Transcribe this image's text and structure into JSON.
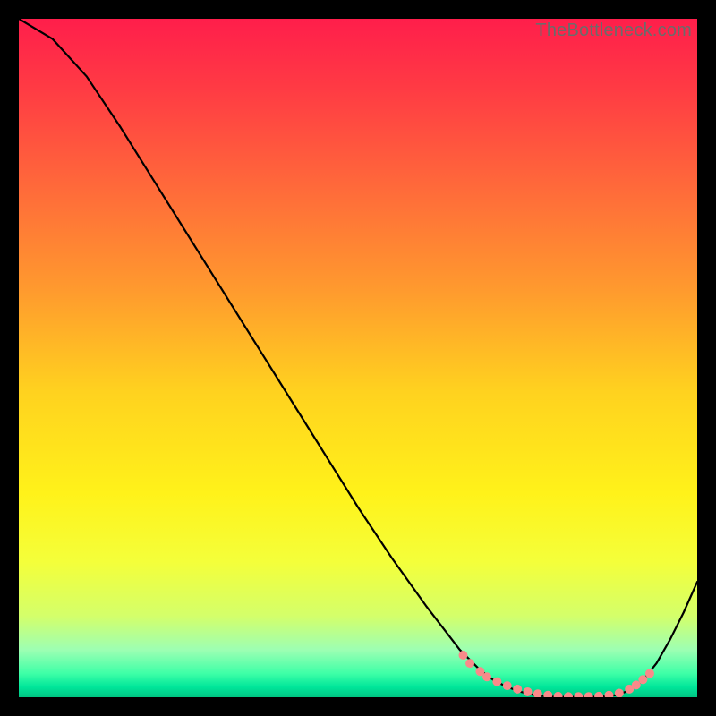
{
  "watermark": "TheBottleneck.com",
  "chart_data": {
    "type": "line",
    "title": "",
    "xlabel": "",
    "ylabel": "",
    "xlim": [
      0,
      100
    ],
    "ylim": [
      0,
      100
    ],
    "grid": false,
    "series": [
      {
        "name": "curve",
        "x": [
          0,
          5,
          10,
          15,
          20,
          25,
          30,
          35,
          40,
          45,
          50,
          55,
          60,
          65,
          68,
          70,
          72,
          74,
          76,
          78,
          80,
          82,
          84,
          86,
          88,
          90,
          92,
          94,
          96,
          98,
          100
        ],
        "y": [
          100,
          97,
          91.5,
          84,
          76,
          68,
          60,
          52,
          44,
          36,
          28,
          20.5,
          13.5,
          7,
          4,
          2.5,
          1.5,
          0.8,
          0.3,
          0.1,
          0.05,
          0.05,
          0.05,
          0.1,
          0.3,
          1,
          2.5,
          5,
          8.5,
          12.5,
          17
        ]
      }
    ],
    "markers": {
      "name": "dots",
      "x": [
        65.5,
        66.5,
        68,
        69,
        70.5,
        72,
        73.5,
        75,
        76.5,
        78,
        79.5,
        81,
        82.5,
        84,
        85.5,
        87,
        88.5,
        90,
        91,
        92,
        93
      ],
      "y": [
        6.2,
        5.0,
        3.8,
        3.0,
        2.3,
        1.7,
        1.2,
        0.8,
        0.5,
        0.3,
        0.15,
        0.1,
        0.1,
        0.1,
        0.15,
        0.3,
        0.6,
        1.2,
        1.8,
        2.6,
        3.5
      ],
      "color": "#f98a8a",
      "radius": 5
    },
    "background_gradient": {
      "stops": [
        {
          "offset": 0.0,
          "color": "#ff1e4b"
        },
        {
          "offset": 0.1,
          "color": "#ff3a44"
        },
        {
          "offset": 0.25,
          "color": "#ff6a3a"
        },
        {
          "offset": 0.4,
          "color": "#ff9a2e"
        },
        {
          "offset": 0.55,
          "color": "#ffd21f"
        },
        {
          "offset": 0.7,
          "color": "#fff21a"
        },
        {
          "offset": 0.8,
          "color": "#f4ff3a"
        },
        {
          "offset": 0.88,
          "color": "#d4ff6a"
        },
        {
          "offset": 0.93,
          "color": "#9dffb3"
        },
        {
          "offset": 0.965,
          "color": "#3effa7"
        },
        {
          "offset": 0.985,
          "color": "#00e69a"
        },
        {
          "offset": 1.0,
          "color": "#00c482"
        }
      ]
    }
  }
}
